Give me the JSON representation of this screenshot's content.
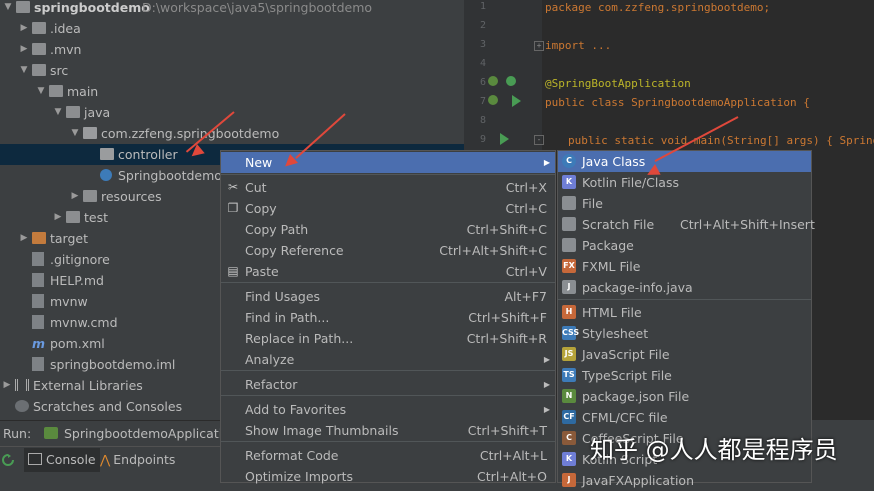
{
  "project": {
    "name": "springbootdemo",
    "path": "D:\\workspace\\java5\\springbootdemo"
  },
  "tree": [
    {
      "label": ".idea",
      "kind": "folder",
      "arrow": "▶"
    },
    {
      "label": ".mvn",
      "kind": "folder",
      "arrow": "▶"
    },
    {
      "label": "src",
      "kind": "folder",
      "arrow": "▼"
    },
    {
      "label": "main",
      "kind": "folder",
      "arrow": "▼"
    },
    {
      "label": "java",
      "kind": "folder",
      "arrow": "▼"
    },
    {
      "label": "com.zzfeng.springbootdemo",
      "kind": "package",
      "arrow": "▼"
    },
    {
      "label": "controller",
      "kind": "package",
      "arrow": ""
    },
    {
      "label": "Springbootdemo",
      "kind": "class",
      "arrow": ""
    },
    {
      "label": "resources",
      "kind": "folder",
      "arrow": "▶"
    },
    {
      "label": "test",
      "kind": "folder",
      "arrow": "▶"
    },
    {
      "label": "target",
      "kind": "folder-orange",
      "arrow": "▶"
    },
    {
      "label": ".gitignore",
      "kind": "file",
      "arrow": ""
    },
    {
      "label": "HELP.md",
      "kind": "file",
      "arrow": ""
    },
    {
      "label": "mvnw",
      "kind": "file",
      "arrow": ""
    },
    {
      "label": "mvnw.cmd",
      "kind": "file",
      "arrow": ""
    },
    {
      "label": "pom.xml",
      "kind": "maven",
      "arrow": ""
    },
    {
      "label": "springbootdemo.iml",
      "kind": "file",
      "arrow": ""
    },
    {
      "label": "External Libraries",
      "kind": "libs",
      "arrow": "▶"
    },
    {
      "label": "Scratches and Consoles",
      "kind": "scratch",
      "arrow": ""
    }
  ],
  "editor": {
    "lines": [
      {
        "num": "1",
        "text": "package com.zzfeng.springbootdemo;"
      },
      {
        "num": "2",
        "text": ""
      },
      {
        "num": "3",
        "text": "import ..."
      },
      {
        "num": "4",
        "text": ""
      },
      {
        "num": "6",
        "text": "@SpringBootApplication"
      },
      {
        "num": "7",
        "text": "public class SpringbootdemoApplication {"
      },
      {
        "num": "8",
        "text": ""
      },
      {
        "num": "9",
        "text": "public static void main(String[] args) { SpringAppl"
      }
    ]
  },
  "context_menu": {
    "items": [
      {
        "label": "New",
        "shortcut": "",
        "submenu": true,
        "icon": "",
        "highlighted": true
      },
      {
        "label": "Cut",
        "shortcut": "Ctrl+X",
        "submenu": false,
        "icon": "scissors-icon"
      },
      {
        "label": "Copy",
        "shortcut": "Ctrl+C",
        "submenu": false,
        "icon": "copy-icon"
      },
      {
        "label": "Copy Path",
        "shortcut": "Ctrl+Shift+C",
        "submenu": false,
        "icon": ""
      },
      {
        "label": "Copy Reference",
        "shortcut": "Ctrl+Alt+Shift+C",
        "submenu": false,
        "icon": ""
      },
      {
        "label": "Paste",
        "shortcut": "Ctrl+V",
        "submenu": false,
        "icon": "paste-icon"
      },
      {
        "label": "Find Usages",
        "shortcut": "Alt+F7",
        "submenu": false,
        "icon": ""
      },
      {
        "label": "Find in Path...",
        "shortcut": "Ctrl+Shift+F",
        "submenu": false,
        "icon": ""
      },
      {
        "label": "Replace in Path...",
        "shortcut": "Ctrl+Shift+R",
        "submenu": false,
        "icon": ""
      },
      {
        "label": "Analyze",
        "shortcut": "",
        "submenu": true,
        "icon": ""
      },
      {
        "label": "Refactor",
        "shortcut": "",
        "submenu": true,
        "icon": ""
      },
      {
        "label": "Add to Favorites",
        "shortcut": "",
        "submenu": true,
        "icon": ""
      },
      {
        "label": "Show Image Thumbnails",
        "shortcut": "Ctrl+Shift+T",
        "submenu": false,
        "icon": ""
      },
      {
        "label": "Reformat Code",
        "shortcut": "Ctrl+Alt+L",
        "submenu": false,
        "icon": ""
      },
      {
        "label": "Optimize Imports",
        "shortcut": "Ctrl+Alt+O",
        "submenu": false,
        "icon": ""
      }
    ]
  },
  "new_submenu": {
    "items": [
      {
        "label": "Java Class",
        "shortcut": "",
        "icon": "C",
        "color": "#3d7bb8",
        "highlighted": true
      },
      {
        "label": "Kotlin File/Class",
        "shortcut": "",
        "icon": "K",
        "color": "#6f7ed6"
      },
      {
        "label": "File",
        "shortcut": "",
        "icon": "",
        "color": "#8a8e92"
      },
      {
        "label": "Scratch File",
        "shortcut": "Ctrl+Alt+Shift+Insert",
        "icon": "",
        "color": "#8a8e92"
      },
      {
        "label": "Package",
        "shortcut": "",
        "icon": "",
        "color": "#8a8e92"
      },
      {
        "label": "FXML File",
        "shortcut": "",
        "icon": "FX",
        "color": "#c6683a"
      },
      {
        "label": "package-info.java",
        "shortcut": "",
        "icon": "J",
        "color": "#8a8e92"
      },
      {
        "label": "HTML File",
        "shortcut": "",
        "icon": "H",
        "color": "#c6683a"
      },
      {
        "label": "Stylesheet",
        "shortcut": "",
        "icon": "CSS",
        "color": "#3d7bb8"
      },
      {
        "label": "JavaScript File",
        "shortcut": "",
        "icon": "JS",
        "color": "#b5a33a"
      },
      {
        "label": "TypeScript File",
        "shortcut": "",
        "icon": "TS",
        "color": "#3d7bb8"
      },
      {
        "label": "package.json File",
        "shortcut": "",
        "icon": "N",
        "color": "#5a8a3e"
      },
      {
        "label": "CFML/CFC file",
        "shortcut": "",
        "icon": "CF",
        "color": "#2e6aa1"
      },
      {
        "label": "CoffeeScript File",
        "shortcut": "",
        "icon": "C",
        "color": "#8a5a3a"
      },
      {
        "label": "Kotlin Script",
        "shortcut": "",
        "icon": "K",
        "color": "#6f7ed6"
      },
      {
        "label": "JavaFXApplication",
        "shortcut": "",
        "icon": "J",
        "color": "#c6683a"
      }
    ]
  },
  "run_bar": {
    "label": "Run:",
    "config": "SpringbootdemoApplicatio"
  },
  "bottom_tabs": [
    {
      "label": "Console"
    },
    {
      "label": "Endpoints"
    }
  ],
  "watermark": "知乎 @人人都是程序员",
  "colors": {
    "highlight": "#4b6eaf",
    "arrow": "#e0483b",
    "selected_row": "#0d293e"
  }
}
